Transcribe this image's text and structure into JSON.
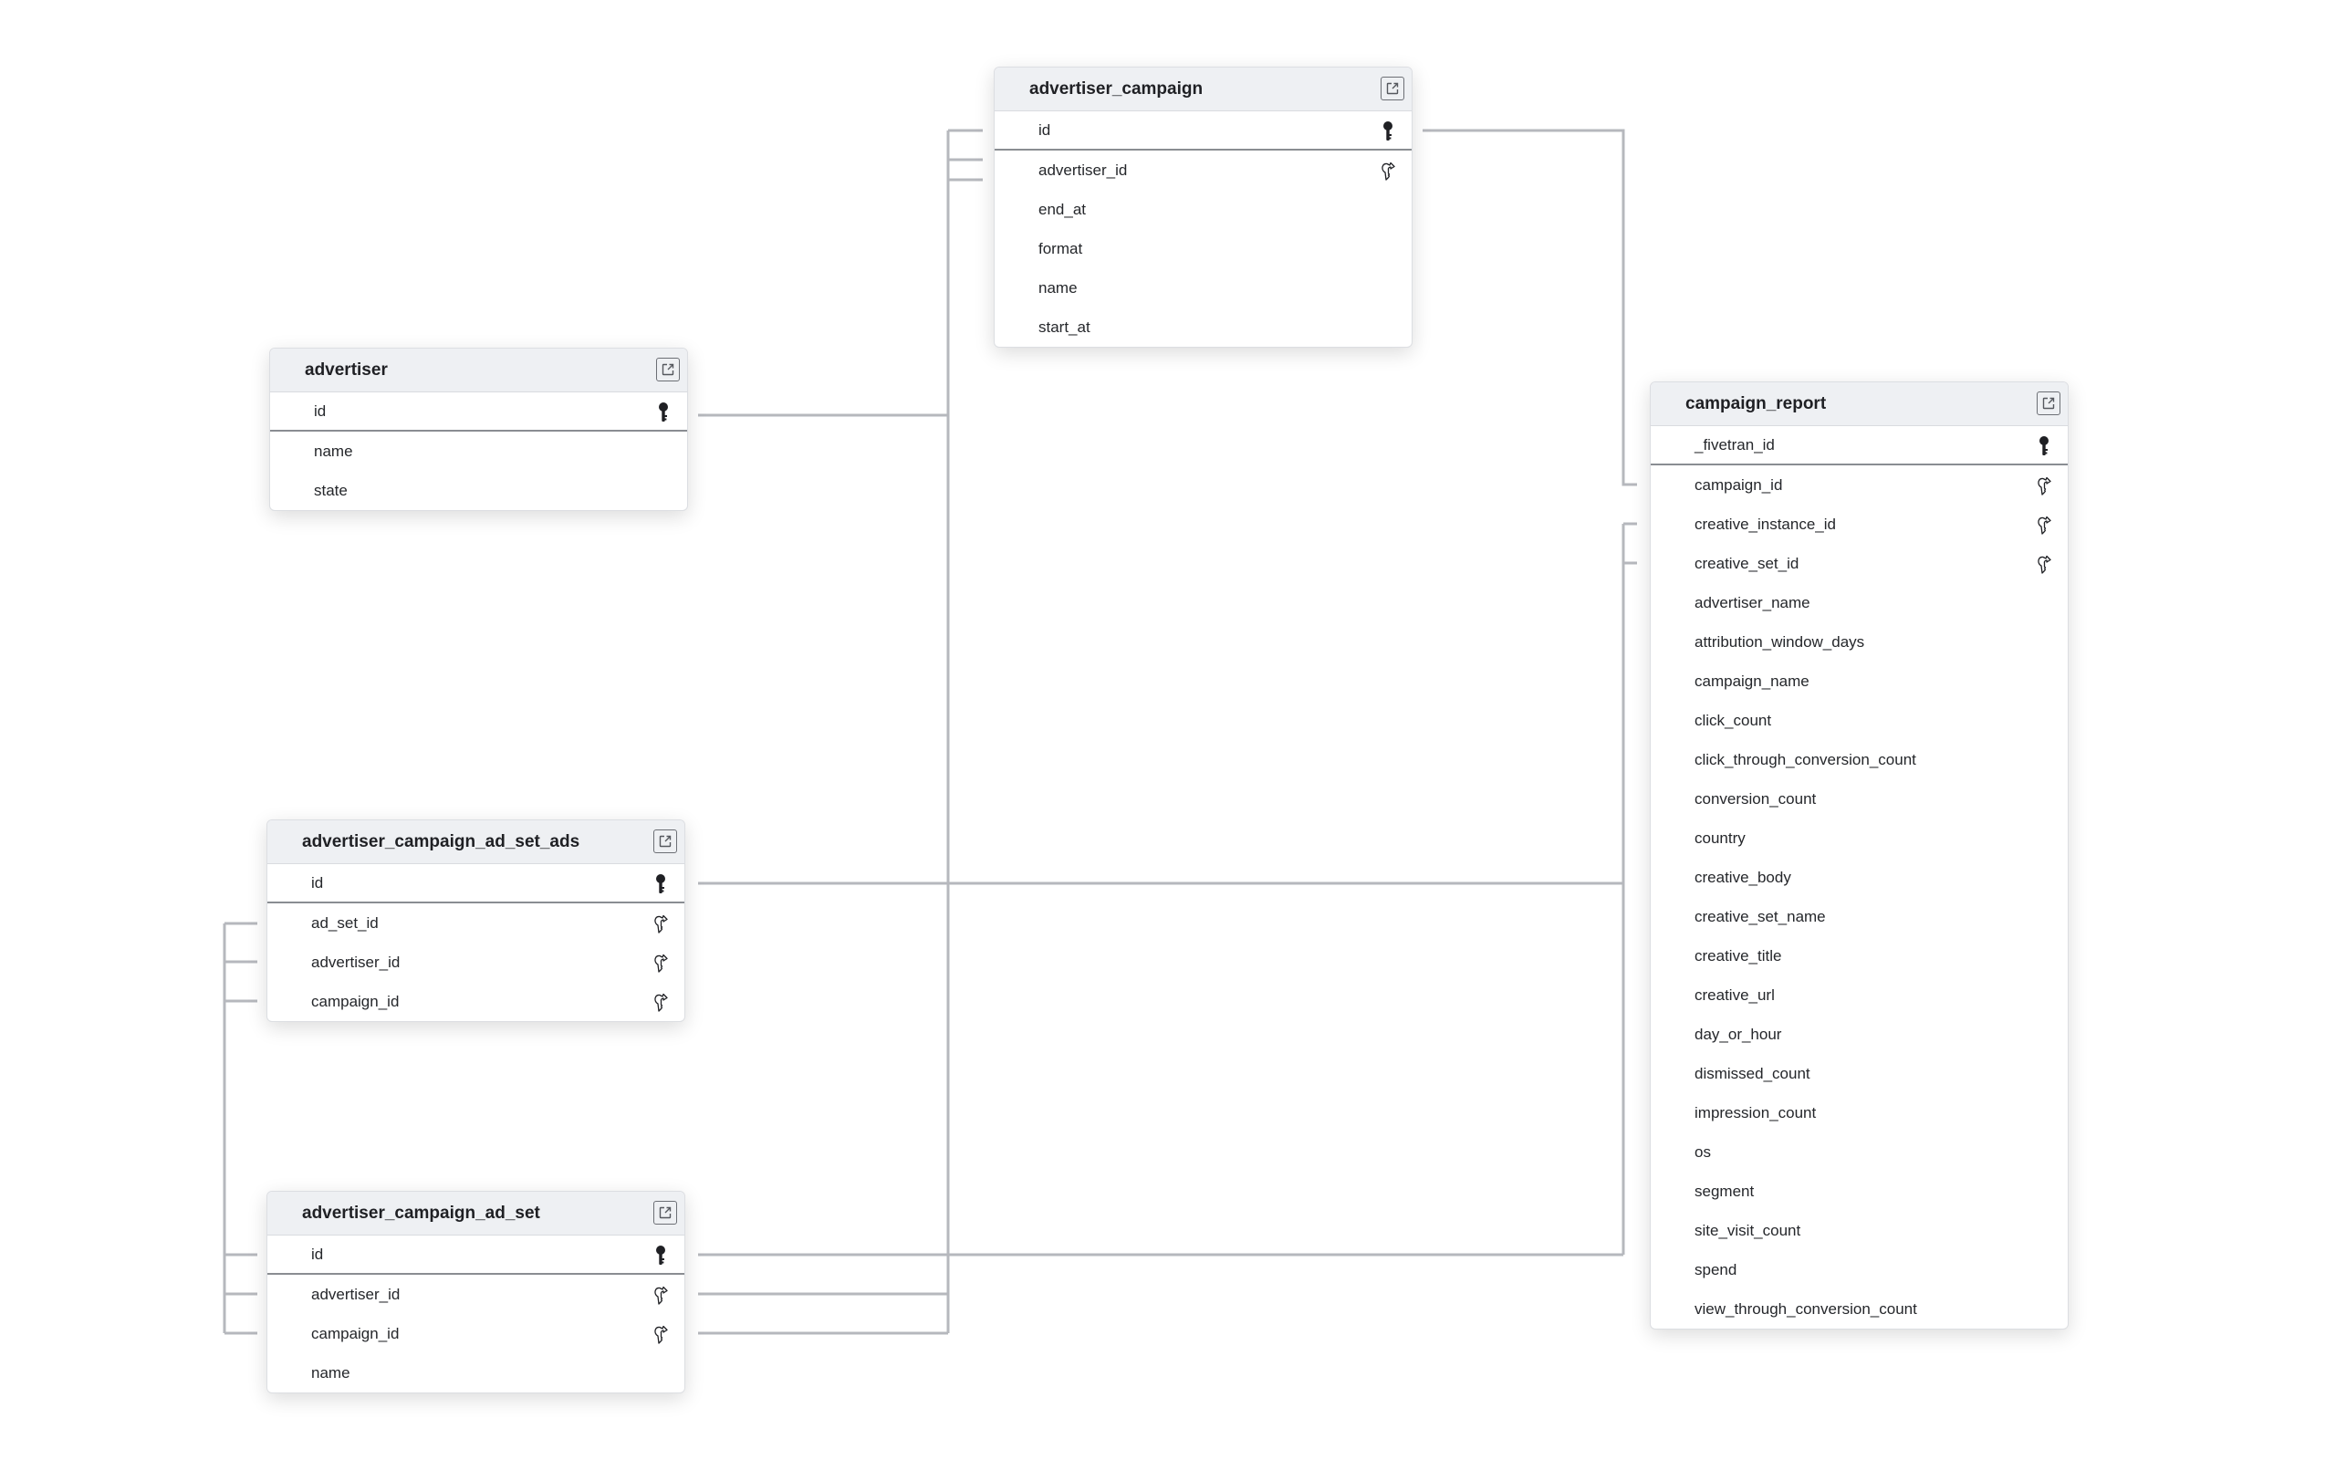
{
  "tables": [
    {
      "id": "advertiser",
      "title": "advertiser",
      "fields": [
        {
          "name": "id",
          "key": "primary"
        },
        {
          "name": "name",
          "key": null
        },
        {
          "name": "state",
          "key": null
        }
      ]
    },
    {
      "id": "advertiser_campaign",
      "title": "advertiser_campaign",
      "fields": [
        {
          "name": "id",
          "key": "primary"
        },
        {
          "name": "advertiser_id",
          "key": "foreign"
        },
        {
          "name": "end_at",
          "key": null
        },
        {
          "name": "format",
          "key": null
        },
        {
          "name": "name",
          "key": null
        },
        {
          "name": "start_at",
          "key": null
        }
      ]
    },
    {
      "id": "advertiser_campaign_ad_set_ads",
      "title": "advertiser_campaign_ad_set_ads",
      "fields": [
        {
          "name": "id",
          "key": "primary"
        },
        {
          "name": "ad_set_id",
          "key": "foreign"
        },
        {
          "name": "advertiser_id",
          "key": "foreign"
        },
        {
          "name": "campaign_id",
          "key": "foreign"
        }
      ]
    },
    {
      "id": "advertiser_campaign_ad_set",
      "title": "advertiser_campaign_ad_set",
      "fields": [
        {
          "name": "id",
          "key": "primary"
        },
        {
          "name": "advertiser_id",
          "key": "foreign"
        },
        {
          "name": "campaign_id",
          "key": "foreign"
        },
        {
          "name": "name",
          "key": null
        }
      ]
    },
    {
      "id": "campaign_report",
      "title": "campaign_report",
      "fields": [
        {
          "name": "_fivetran_id",
          "key": "primary"
        },
        {
          "name": "campaign_id",
          "key": "foreign"
        },
        {
          "name": "creative_instance_id",
          "key": "foreign"
        },
        {
          "name": "creative_set_id",
          "key": "foreign"
        },
        {
          "name": "advertiser_name",
          "key": null
        },
        {
          "name": "attribution_window_days",
          "key": null
        },
        {
          "name": "campaign_name",
          "key": null
        },
        {
          "name": "click_count",
          "key": null
        },
        {
          "name": "click_through_conversion_count",
          "key": null
        },
        {
          "name": "conversion_count",
          "key": null
        },
        {
          "name": "country",
          "key": null
        },
        {
          "name": "creative_body",
          "key": null
        },
        {
          "name": "creative_set_name",
          "key": null
        },
        {
          "name": "creative_title",
          "key": null
        },
        {
          "name": "creative_url",
          "key": null
        },
        {
          "name": "day_or_hour",
          "key": null
        },
        {
          "name": "dismissed_count",
          "key": null
        },
        {
          "name": "impression_count",
          "key": null
        },
        {
          "name": "os",
          "key": null
        },
        {
          "name": "segment",
          "key": null
        },
        {
          "name": "site_visit_count",
          "key": null
        },
        {
          "name": "spend",
          "key": null
        },
        {
          "name": "view_through_conversion_count",
          "key": null
        }
      ]
    }
  ],
  "relationships": [
    {
      "from": "advertiser_campaign.advertiser_id",
      "to": "advertiser.id"
    },
    {
      "from": "advertiser_campaign_ad_set_ads.advertiser_id",
      "to": "advertiser.id"
    },
    {
      "from": "advertiser_campaign_ad_set.advertiser_id",
      "to": "advertiser.id"
    },
    {
      "from": "advertiser_campaign_ad_set_ads.campaign_id",
      "to": "advertiser_campaign.id"
    },
    {
      "from": "advertiser_campaign_ad_set.campaign_id",
      "to": "advertiser_campaign.id"
    },
    {
      "from": "campaign_report.campaign_id",
      "to": "advertiser_campaign.id"
    },
    {
      "from": "advertiser_campaign_ad_set_ads.ad_set_id",
      "to": "advertiser_campaign_ad_set.id"
    },
    {
      "from": "campaign_report.creative_instance_id",
      "to": "advertiser_campaign_ad_set_ads.id"
    },
    {
      "from": "campaign_report.creative_set_id",
      "to": "advertiser_campaign_ad_set.id"
    }
  ],
  "colors": {
    "header_bg": "#eef0f3",
    "connector": "#b6b8bd",
    "text": "#25272b"
  }
}
